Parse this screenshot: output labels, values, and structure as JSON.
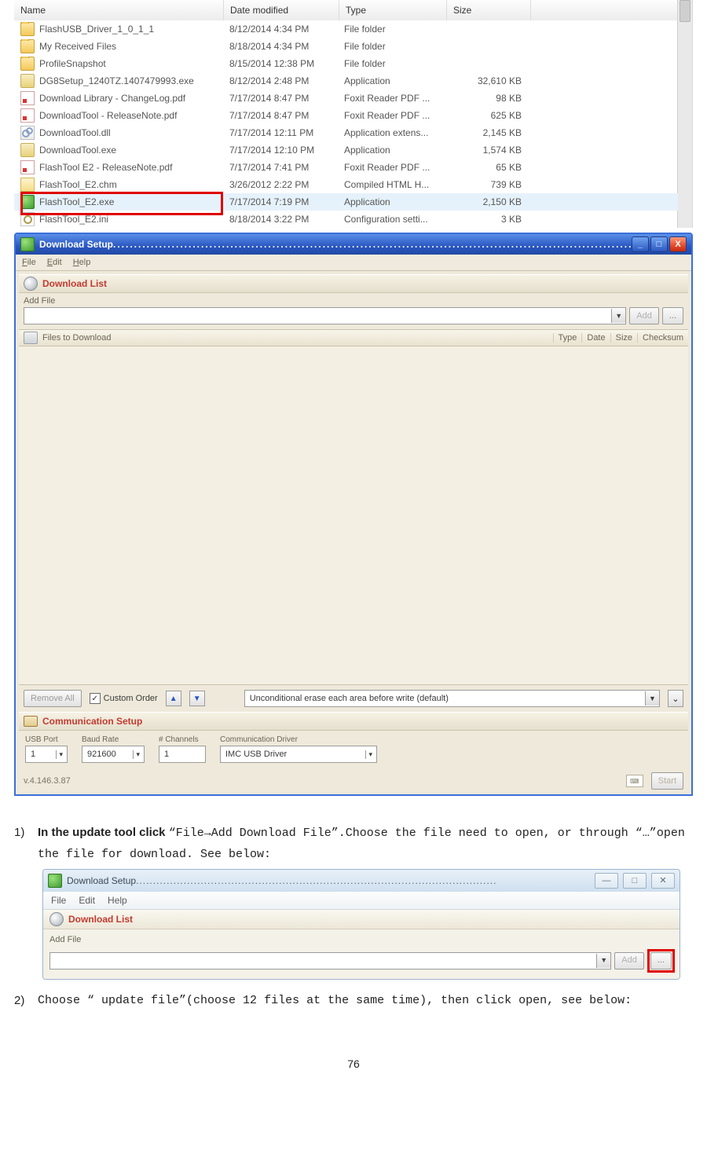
{
  "explorer": {
    "columns": {
      "name": "Name",
      "date": "Date modified",
      "type": "Type",
      "size": "Size"
    },
    "rows": [
      {
        "icon": "ic-folder",
        "name": "FlashUSB_Driver_1_0_1_1",
        "date": "8/12/2014 4:34 PM",
        "type": "File folder",
        "size": ""
      },
      {
        "icon": "ic-folder",
        "name": "My Received Files",
        "date": "8/18/2014 4:34 PM",
        "type": "File folder",
        "size": ""
      },
      {
        "icon": "ic-folder",
        "name": "ProfileSnapshot",
        "date": "8/15/2014 12:38 PM",
        "type": "File folder",
        "size": ""
      },
      {
        "icon": "ic-exe",
        "name": "DG8Setup_1240TZ.1407479993.exe",
        "date": "8/12/2014 2:48 PM",
        "type": "Application",
        "size": "32,610 KB"
      },
      {
        "icon": "ic-pdf",
        "name": "Download Library - ChangeLog.pdf",
        "date": "7/17/2014 8:47 PM",
        "type": "Foxit Reader PDF ...",
        "size": "98 KB"
      },
      {
        "icon": "ic-pdf",
        "name": "DownloadTool - ReleaseNote.pdf",
        "date": "7/17/2014 8:47 PM",
        "type": "Foxit Reader PDF ...",
        "size": "625 KB"
      },
      {
        "icon": "ic-dll",
        "name": "DownloadTool.dll",
        "date": "7/17/2014 12:11 PM",
        "type": "Application extens...",
        "size": "2,145 KB"
      },
      {
        "icon": "ic-exe",
        "name": "DownloadTool.exe",
        "date": "7/17/2014 12:10 PM",
        "type": "Application",
        "size": "1,574 KB"
      },
      {
        "icon": "ic-pdf",
        "name": "FlashTool E2 - ReleaseNote.pdf",
        "date": "7/17/2014 7:41 PM",
        "type": "Foxit Reader PDF ...",
        "size": "65 KB"
      },
      {
        "icon": "ic-chm",
        "name": "FlashTool_E2.chm",
        "date": "3/26/2012 2:22 PM",
        "type": "Compiled HTML H...",
        "size": "739 KB"
      },
      {
        "icon": "ic-green",
        "name": "FlashTool_E2.exe",
        "date": "7/17/2014 7:19 PM",
        "type": "Application",
        "size": "2,150 KB",
        "selected": true,
        "highlighted": true
      },
      {
        "icon": "ic-ini",
        "name": "FlashTool_E2.ini",
        "date": "8/18/2014 3:22 PM",
        "type": "Configuration setti...",
        "size": "3 KB"
      }
    ]
  },
  "xp": {
    "title": "Download Setup",
    "menu": {
      "file": "File",
      "edit": "Edit",
      "help": "Help"
    },
    "dl_header": "Download List",
    "addfile_label": "Add File",
    "add_btn": "Add",
    "browse_btn": "...",
    "flh_label": "Files to Download",
    "flh_cols": {
      "type": "Type",
      "date": "Date",
      "size": "Size",
      "chk": "Checksum"
    },
    "remove_btn": "Remove All",
    "custom_order": "Custom Order",
    "erase_text": "Unconditional erase each area before write (default)",
    "comm_header": "Communication Setup",
    "usb_port": {
      "label": "USB Port",
      "value": "1"
    },
    "baud": {
      "label": "Baud Rate",
      "value": "921600"
    },
    "channels": {
      "label": "# Channels",
      "value": "1"
    },
    "driver": {
      "label": "Communication Driver",
      "value": "IMC USB Driver"
    },
    "version": "v.4.146.3.87",
    "start_btn": "Start"
  },
  "text": {
    "step1_num": "1)",
    "step1_lead": "In the update tool click ",
    "step1_mono1": "“File→Add Download File”",
    "step1_mid": ".Choose the file need to open, or through ",
    "step1_mono2": "“…”",
    "step1_tail": "open the file for download. See below:",
    "step2_num": "2)",
    "step2_a": "Choose ",
    "step2_b": "“ update file”",
    "step2_c": "(choose 12 files at the same time), then click open, see below:"
  },
  "w7": {
    "title": "Download Setup",
    "menu": {
      "file": "File",
      "edit": "Edit",
      "help": "Help"
    },
    "dl_header": "Download List",
    "addfile_label": "Add File",
    "add_btn": "Add",
    "browse_btn": "..."
  },
  "page_number": "76"
}
